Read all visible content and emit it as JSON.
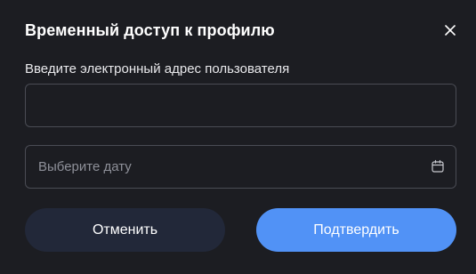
{
  "dialog": {
    "title": "Временный доступ к профилю",
    "close_icon": "close-icon",
    "email": {
      "label": "Введите электронный адрес пользователя",
      "value": "",
      "placeholder": ""
    },
    "date": {
      "placeholder": "Выберите дату",
      "icon": "calendar-icon"
    },
    "buttons": {
      "cancel_label": "Отменить",
      "confirm_label": "Подтвердить"
    }
  },
  "colors": {
    "background": "#1c1d22",
    "border": "#4a4c54",
    "cancel_bg": "#222839",
    "confirm_bg": "#5192f6",
    "placeholder": "#8e9099"
  }
}
